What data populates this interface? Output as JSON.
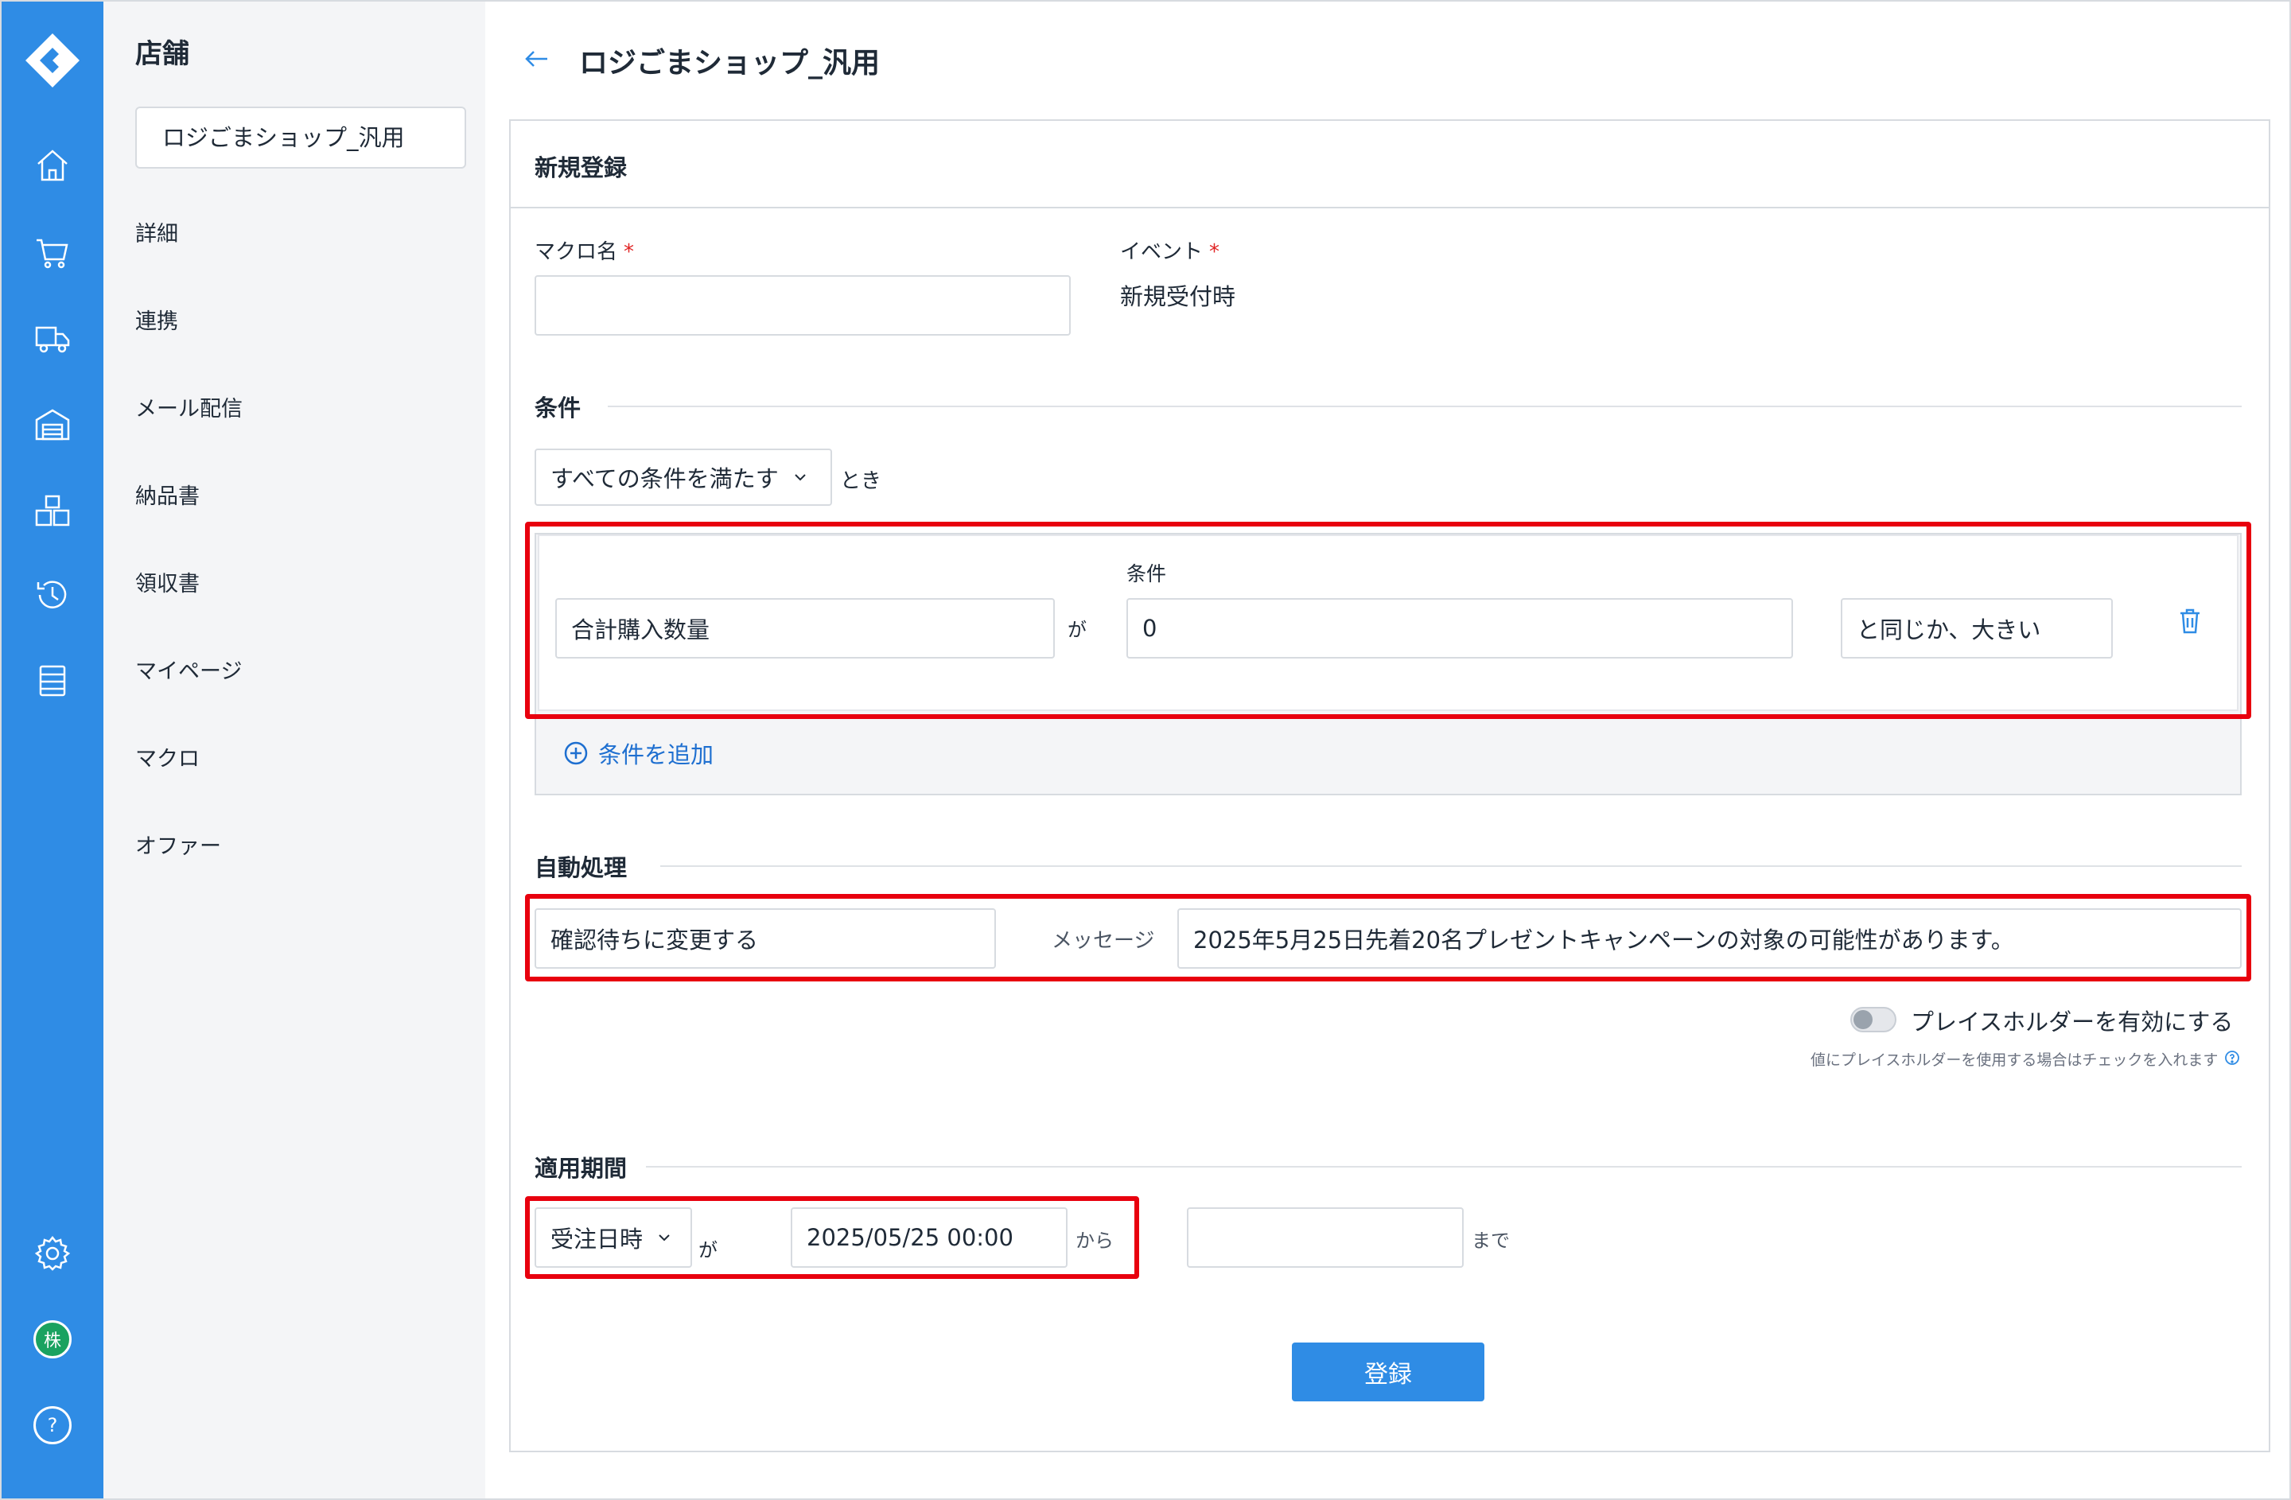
{
  "sidebar": {
    "title": "店舗",
    "store_selected": "ロジごまショップ_汎用",
    "items": [
      {
        "label": "詳細"
      },
      {
        "label": "連携"
      },
      {
        "label": "メール配信"
      },
      {
        "label": "納品書"
      },
      {
        "label": "領収書"
      },
      {
        "label": "マイページ"
      },
      {
        "label": "マクロ"
      },
      {
        "label": "オファー"
      }
    ]
  },
  "rail": {
    "icons": [
      "home-icon",
      "cart-icon",
      "truck-icon",
      "warehouse-icon",
      "boxes-icon",
      "history-icon",
      "list-icon",
      "settings-icon",
      "company-icon",
      "help-icon"
    ],
    "company_badge": "株",
    "help_glyph": "?"
  },
  "header": {
    "title": "ロジごまショップ_汎用"
  },
  "form": {
    "card_title": "新規登録",
    "macro_name_label": "マクロ名",
    "macro_name_value": "",
    "required_mark": "*",
    "event_label": "イベント",
    "event_value": "新規受付時",
    "conditions_title": "条件",
    "match_mode": "すべての条件を満たす",
    "match_suffix": "とき",
    "condition_row": {
      "field": "合計購入数量",
      "particle": "が",
      "value_label": "条件",
      "value": "0",
      "operator": "と同じか、大きい"
    },
    "add_condition": "条件を追加",
    "auto_title": "自動処理",
    "action": "確認待ちに変更する",
    "message_label": "メッセージ",
    "message_value": "2025年5月25日先着20名プレゼントキャンペーンの対象の可能性があります。",
    "placeholder_toggle_label": "プレイスホルダーを有効にする",
    "placeholder_help": "値にプレイスホルダーを使用する場合はチェックを入れます",
    "placeholder_enabled": false,
    "period_title": "適用期間",
    "period_basis": "受注日時",
    "period_particle": "が",
    "period_from": "2025/05/25 00:00",
    "from_suffix": "から",
    "period_to": "",
    "to_suffix": "まで",
    "submit_label": "登録"
  },
  "colors": {
    "rail": "#2f8ce5",
    "sidebar_bg": "#f4f5f7",
    "primary": "#2f8ce5",
    "link": "#1e6fd0",
    "highlight": "#e8000e",
    "required": "#e02424",
    "badge": "#1aa260"
  }
}
